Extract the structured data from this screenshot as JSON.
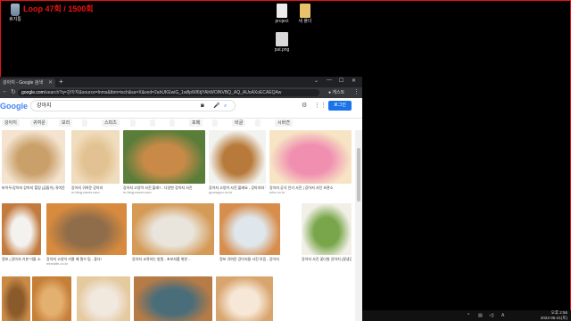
{
  "overlay": {
    "loop_label": "Loop 47회 / 1500회",
    "frame_color": "#ee1111"
  },
  "desktop": {
    "icons": [
      {
        "label": "휴지통",
        "icon": "recycle-bin-icon"
      },
      {
        "label": "project",
        "icon": "folder-icon"
      },
      {
        "label": "새 폴더",
        "icon": "folder-icon"
      },
      {
        "label": "pat.png",
        "icon": "image-file-icon"
      }
    ]
  },
  "browser": {
    "tab_title": "강아지 - Google 검색",
    "url_host": "google.com",
    "url_rest": "/search?q=강아지&source=lnms&tbm=isch&sa=X&ved=2ahUKEwiG_1w8pWl6tjYAhWOlNVBQ_AQ_AUoAXoECAEQAw",
    "profile_label": "게스트",
    "search_query": "강아지",
    "logo_text": "Google",
    "login_label": "로그인",
    "chips": [
      "강아지",
      "귀여운",
      "보리",
      "",
      "스피츠",
      "",
      "",
      "",
      "포메",
      "",
      "비글",
      "",
      "시바견"
    ],
    "results": [
      {
        "caption": "바이두/강아지 강아지 힐링 (곰돌이) 귀여운 강아지...",
        "source": "",
        "colors": [
          "#caa06a",
          "#f3e3cf"
        ]
      },
      {
        "caption": "강아지 귀여운 강아지",
        "source": "m.blog.naver.com",
        "colors": [
          "#e2c292",
          "#f0ddbe"
        ]
      },
      {
        "caption": "강아지 고양이 사진 볼래? - 다양한 강아지 사진",
        "source": "m.blog.naver.com",
        "colors": [
          "#c98a48",
          "#5a7d3a"
        ]
      },
      {
        "caption": "강아지 고양이 사진 볼래요 - 강아지와 함께하는 방법을 알아보자",
        "source": "ppomppu.co.kr",
        "colors": [
          "#b87a3a",
          "#f2f2ee"
        ]
      },
      {
        "caption": "강아지 공식 인기 사진 | 강아지 사진 보관소",
        "source": "mbc.co.kr",
        "colors": [
          "#f08fb0",
          "#f7e4c4"
        ]
      },
      {
        "caption": "정보 | 강아지 기본 이름 소개 (꼬리) ...",
        "source": "",
        "colors": [
          "#f4f2ef",
          "#c27a3f"
        ]
      },
      {
        "caption": "강아지 고양이 키울 때 필수 팁 - 좋다!",
        "source": "mhealth.co.kr",
        "colors": [
          "#8f6d4a",
          "#d88b3e"
        ]
      },
      {
        "caption": "강아지 교육하는 방법 - 초보자를 위한 ...",
        "source": "",
        "colors": [
          "#e9e5dc",
          "#d59a56"
        ]
      },
      {
        "caption": "정보 귀여운 강아지들 사진 모음 - 강아지 ...",
        "source": "",
        "colors": [
          "#dfe7ec",
          "#d78d4c"
        ]
      },
      {
        "caption": "강아지 사진 꽃다발 강아지 (잘생김) 사진...",
        "source": "",
        "colors": [
          "#79a64a",
          "#f1efe6"
        ]
      },
      {
        "caption": "",
        "source": "",
        "colors": [
          "#8a5a2a",
          "#c98a48"
        ]
      },
      {
        "caption": "",
        "source": "",
        "colors": [
          "#e4b070",
          "#c67f38"
        ]
      },
      {
        "caption": "",
        "source": "",
        "colors": [
          "#f1e8de",
          "#e5c99f"
        ]
      },
      {
        "caption": "",
        "source": "",
        "colors": [
          "#4a6d7a",
          "#b77b46"
        ]
      },
      {
        "caption": "",
        "source": "",
        "colors": [
          "#f6e7d6",
          "#d9a56e"
        ]
      }
    ]
  },
  "taskbar": {
    "time": "오후 2:56",
    "date": "2022-05-21(토)"
  }
}
